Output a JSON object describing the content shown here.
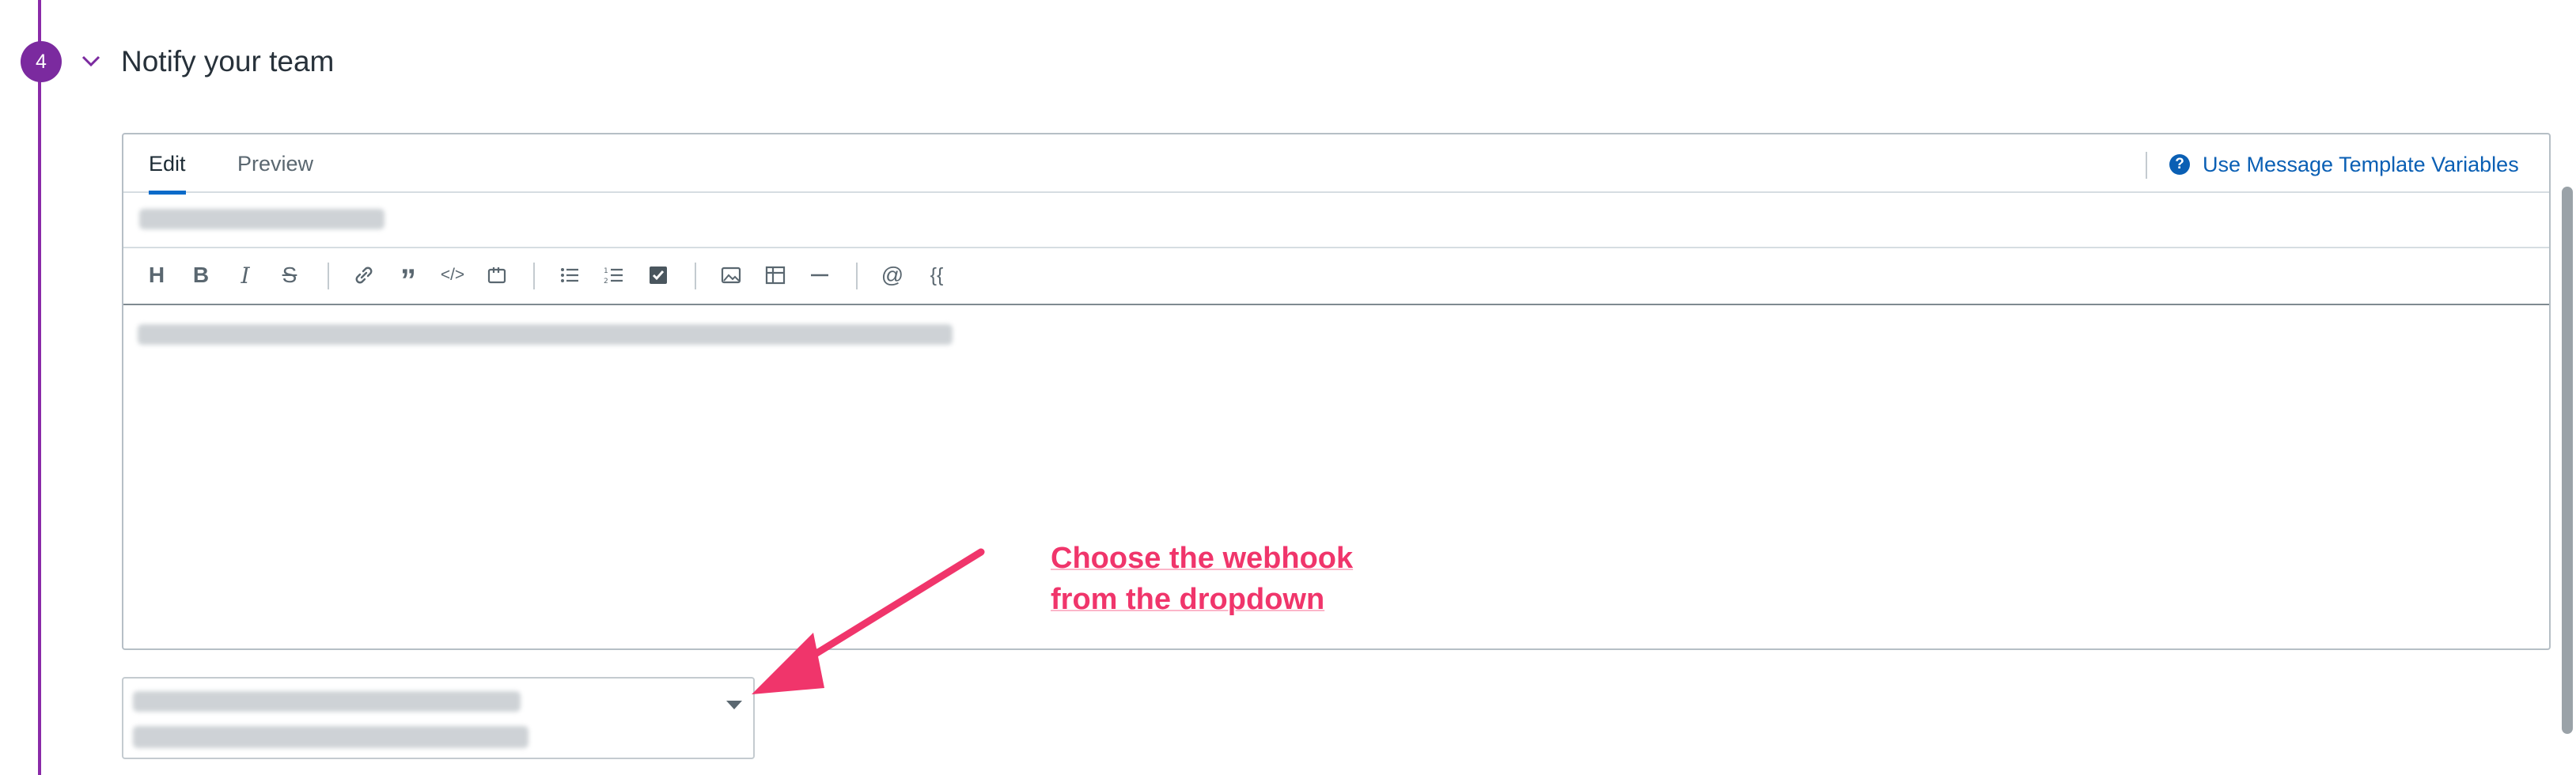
{
  "section": {
    "step_number": "4",
    "title": "Notify your team"
  },
  "editor": {
    "tabs": [
      {
        "label": "Edit",
        "active": true
      },
      {
        "label": "Preview",
        "active": false
      }
    ],
    "template_link": "Use Message Template Variables",
    "help_icon_glyph": "?",
    "toolbar": [
      {
        "icon": "heading-icon",
        "glyph": "H"
      },
      {
        "icon": "bold-icon",
        "glyph": "B"
      },
      {
        "icon": "italic-icon",
        "glyph": "I"
      },
      {
        "icon": "strikethrough-icon",
        "glyph": "S"
      },
      {
        "icon": "link-icon"
      },
      {
        "icon": "quote-icon",
        "glyph": "”"
      },
      {
        "icon": "code-icon",
        "glyph": "</>"
      },
      {
        "icon": "code-block-icon"
      },
      {
        "icon": "bulleted-list-icon"
      },
      {
        "icon": "numbered-list-icon"
      },
      {
        "icon": "checklist-icon"
      },
      {
        "icon": "image-icon"
      },
      {
        "icon": "table-icon"
      },
      {
        "icon": "horizontal-rule-icon"
      },
      {
        "icon": "mention-icon",
        "glyph": "@"
      },
      {
        "icon": "template-variable-icon",
        "glyph": "{{"
      }
    ]
  },
  "annotation": {
    "line1": "Choose the webhook",
    "line2": "from the dropdown"
  },
  "colors": {
    "accent_purple": "#7b2a9f",
    "link_blue": "#0a5fb4",
    "annotation_pink": "#f0356b"
  }
}
